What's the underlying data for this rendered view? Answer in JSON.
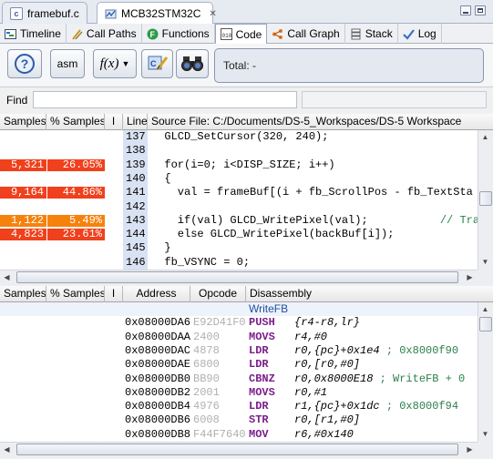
{
  "editor_tabs": {
    "file_tab": "framebuf.c",
    "active_tab": "MCB32STM32C",
    "close_glyph": "✕"
  },
  "view_tabs": [
    {
      "label": "Timeline",
      "icon": "timeline-icon"
    },
    {
      "label": "Call Paths",
      "icon": "call-paths-icon"
    },
    {
      "label": "Functions",
      "icon": "functions-icon"
    },
    {
      "label": "Code",
      "icon": "code-icon",
      "active": true
    },
    {
      "label": "Call Graph",
      "icon": "call-graph-icon"
    },
    {
      "label": "Stack",
      "icon": "stack-icon"
    },
    {
      "label": "Log",
      "icon": "log-icon"
    }
  ],
  "toolbar": {
    "help_glyph": "?",
    "asm_label": "asm",
    "fx_label": "f(x)",
    "total_label": "Total: -"
  },
  "find": {
    "label": "Find",
    "value": ""
  },
  "source_table": {
    "headers": [
      "Samples",
      "% Samples",
      "I",
      "Line",
      "Source File: C:/Documents/DS-5_Workspaces/DS-5 Workspace"
    ],
    "rows": [
      {
        "samples": "",
        "pct": "",
        "line": "137",
        "code": "  GLCD_SetCursor(320, 240);"
      },
      {
        "samples": "",
        "pct": "",
        "line": "138",
        "code": ""
      },
      {
        "samples": "5,321",
        "pct": "26.05%",
        "line": "139",
        "code": "  for(i=0; i<DISP_SIZE; i++)"
      },
      {
        "samples": "",
        "pct": "",
        "line": "140",
        "code": "  {"
      },
      {
        "samples": "9,164",
        "pct": "44.86%",
        "line": "141",
        "code": "    val = frameBuf[(i + fb_ScrollPos - fb_TextSta"
      },
      {
        "samples": "",
        "pct": "",
        "line": "142",
        "code": ""
      },
      {
        "samples": "1,122",
        "pct": "5.49%",
        "line": "143",
        "code": "    if(val) GLCD_WritePixel(val);",
        "comment": "// Tra"
      },
      {
        "samples": "4,823",
        "pct": "23.61%",
        "line": "144",
        "code": "    else GLCD_WritePixel(backBuf[i]);"
      },
      {
        "samples": "",
        "pct": "",
        "line": "145",
        "code": "  }"
      },
      {
        "samples": "",
        "pct": "",
        "line": "146",
        "code": "  fb_VSYNC = 0;"
      }
    ]
  },
  "disasm_table": {
    "headers": [
      "Samples",
      "% Samples",
      "I",
      "Address",
      "Opcode",
      "Disassembly"
    ],
    "function_label": "WriteFB",
    "rows": [
      {
        "address": "0x08000DA6",
        "opcode": "E92D41F0",
        "mnemonic": "PUSH",
        "operands": "{r4-r8,lr}",
        "comment": ""
      },
      {
        "address": "0x08000DAA",
        "opcode": "2400",
        "mnemonic": "MOVS",
        "operands": "r4,#0",
        "comment": ""
      },
      {
        "address": "0x08000DAC",
        "opcode": "4878",
        "mnemonic": "LDR",
        "operands": "r0,{pc}+0x1e4",
        "comment": "; 0x8000f90"
      },
      {
        "address": "0x08000DAE",
        "opcode": "6800",
        "mnemonic": "LDR",
        "operands": "r0,[r0,#0]",
        "comment": ""
      },
      {
        "address": "0x08000DB0",
        "opcode": "BB90",
        "mnemonic": "CBNZ",
        "operands": "r0,0x8000E18",
        "comment": "; WriteFB + 0"
      },
      {
        "address": "0x08000DB2",
        "opcode": "2001",
        "mnemonic": "MOVS",
        "operands": "r0,#1",
        "comment": ""
      },
      {
        "address": "0x08000DB4",
        "opcode": "4976",
        "mnemonic": "LDR",
        "operands": "r1,{pc}+0x1dc",
        "comment": "; 0x8000f94"
      },
      {
        "address": "0x08000DB6",
        "opcode": "6008",
        "mnemonic": "STR",
        "operands": "r0,[r1,#0]",
        "comment": ""
      },
      {
        "address": "0x08000DB8",
        "opcode": "F44F7640",
        "mnemonic": "MOV",
        "operands": "r6,#0x140",
        "comment": ""
      }
    ]
  },
  "colors": {
    "hot_red": "#f0401c",
    "hot_orange": "#f5820d",
    "gutter_blue": "#d9e2f3",
    "mnemonic_purple": "#7b1e8c",
    "comment_green": "#2b7f4b"
  }
}
